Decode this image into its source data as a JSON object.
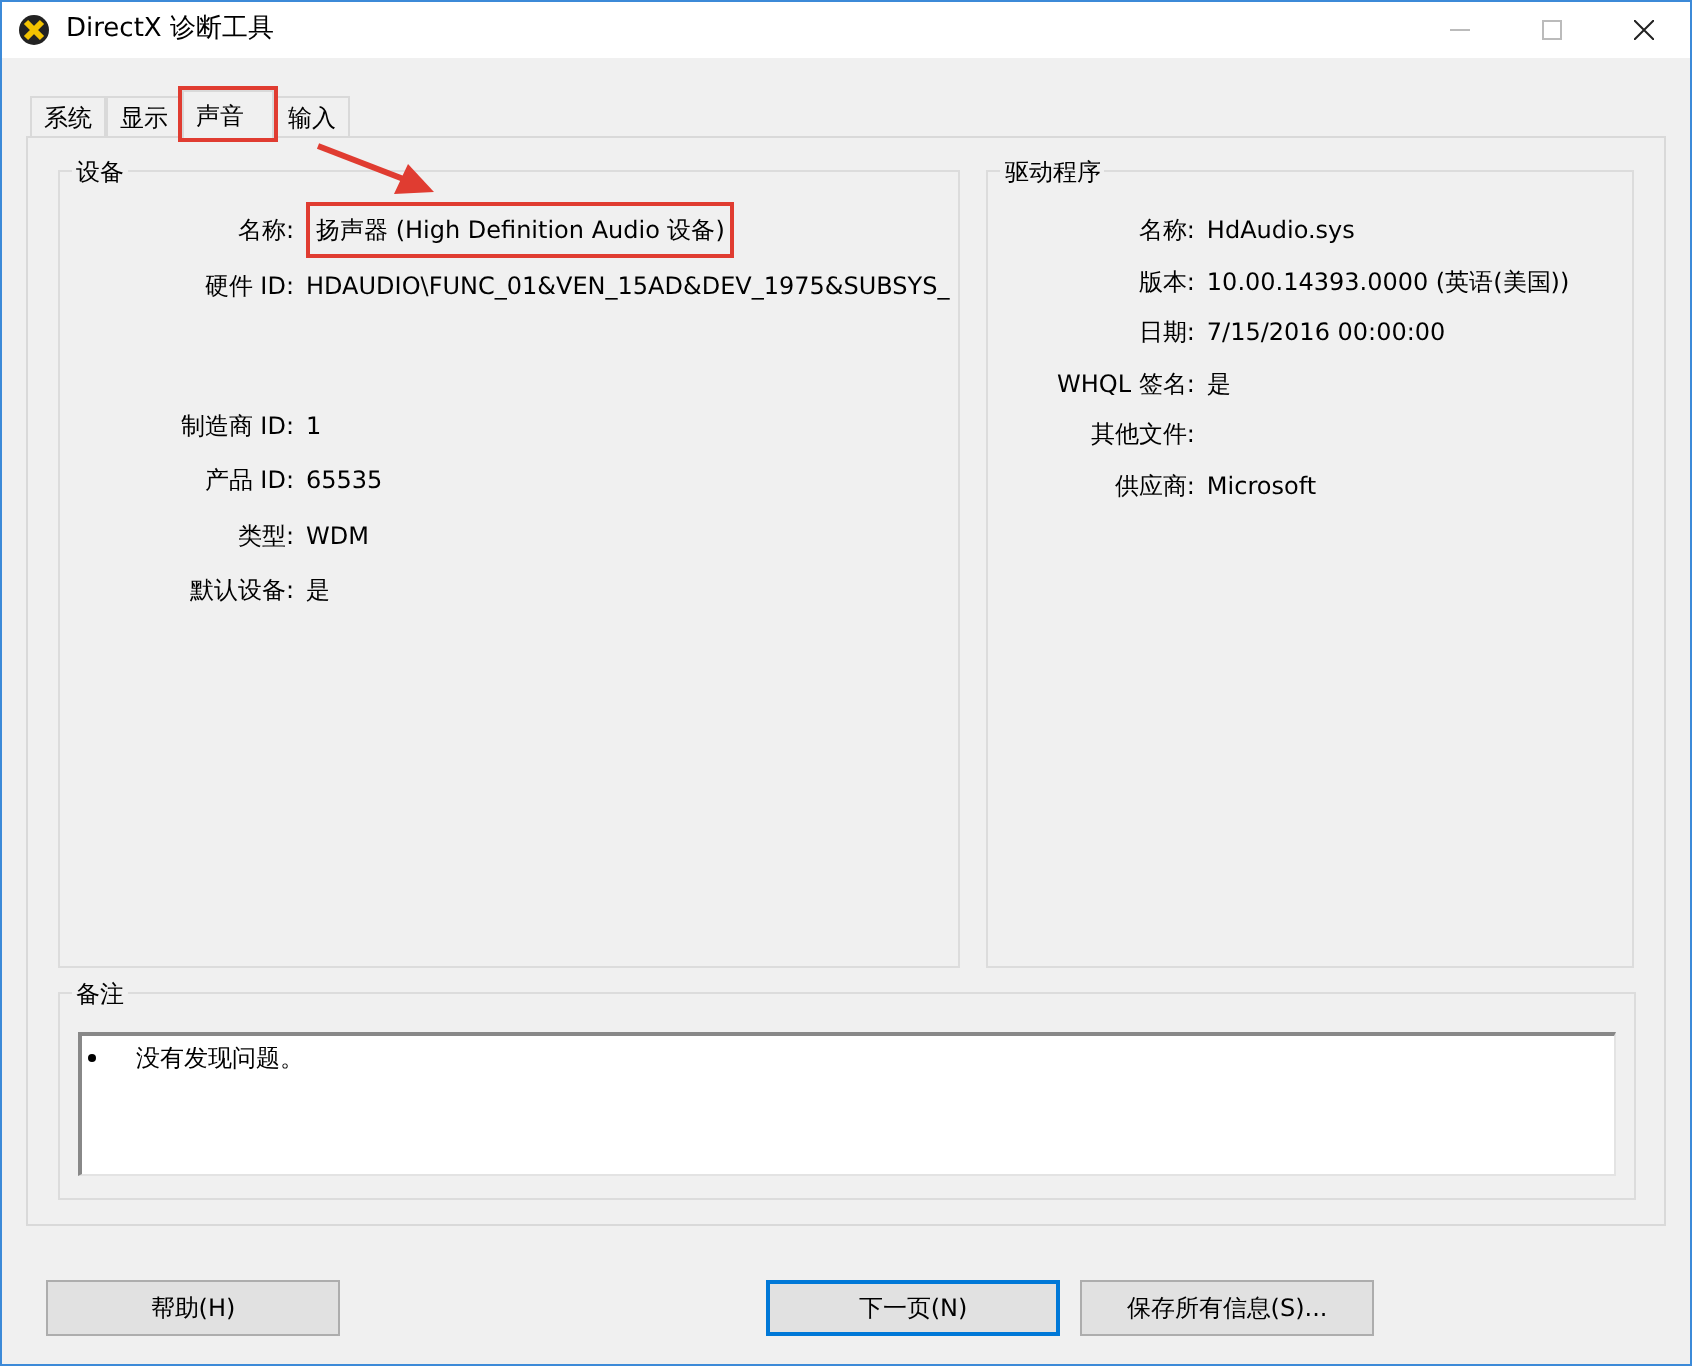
{
  "window": {
    "title": "DirectX 诊断工具"
  },
  "tabs": [
    {
      "label": "系统",
      "selected": false,
      "highlighted": false
    },
    {
      "label": "显示",
      "selected": false,
      "highlighted": false
    },
    {
      "label": "声音",
      "selected": true,
      "highlighted": true
    },
    {
      "label": "输入",
      "selected": false,
      "highlighted": false
    }
  ],
  "device": {
    "title": "设备",
    "rows": [
      {
        "label": "名称:",
        "value": "扬声器 (High Definition Audio 设备)",
        "highlighted": true,
        "kind": "line"
      },
      {
        "label": "硬件 ID:",
        "value": "HDAUDIO\\FUNC_01&VEN_15AD&DEV_1975&SUBSYS_",
        "highlighted": false,
        "kind": "block"
      },
      {
        "label": "制造商 ID:",
        "value": "1",
        "highlighted": false,
        "kind": "line"
      },
      {
        "label": "产品 ID:",
        "value": "65535",
        "highlighted": false,
        "kind": "line"
      },
      {
        "label": "类型:",
        "value": "WDM",
        "highlighted": false,
        "kind": "line"
      },
      {
        "label": "默认设备:",
        "value": "是",
        "highlighted": false,
        "kind": "line"
      }
    ]
  },
  "driver": {
    "title": "驱动程序",
    "rows": [
      {
        "label": "名称:",
        "value": "HdAudio.sys"
      },
      {
        "label": "版本:",
        "value": "10.00.14393.0000 (英语(美国))"
      },
      {
        "label": "日期:",
        "value": "7/15/2016 00:00:00"
      },
      {
        "label": "WHQL 签名:",
        "value": "是"
      },
      {
        "label": "其他文件:"
      },
      {
        "label": "供应商:",
        "value": "Microsoft"
      }
    ]
  },
  "notes": {
    "title": "备注",
    "items": [
      "没有发现问题。"
    ]
  },
  "buttons": [
    {
      "label": "帮助(H)",
      "default": false
    },
    {
      "label": "下一页(N)",
      "default": true
    },
    {
      "label": "保存所有信息(S)...",
      "default": false
    }
  ]
}
